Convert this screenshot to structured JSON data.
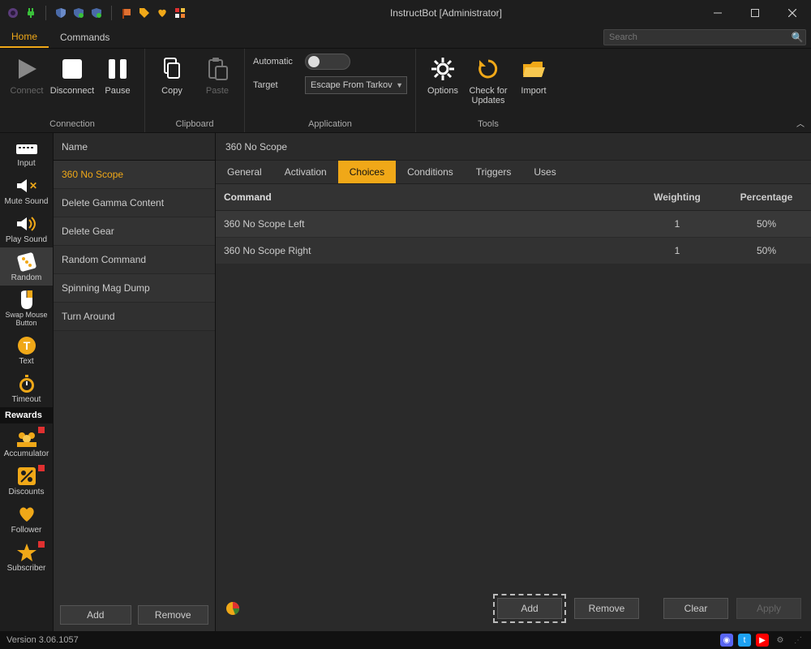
{
  "window": {
    "title": "InstructBot [Administrator]"
  },
  "menubar": {
    "tabs": [
      {
        "label": "Home"
      },
      {
        "label": "Commands"
      }
    ],
    "active": 0,
    "search_placeholder": "Search"
  },
  "ribbon": {
    "groups": {
      "connection": {
        "label": "Connection",
        "items": [
          {
            "label": "Connect",
            "disabled": true
          },
          {
            "label": "Disconnect"
          },
          {
            "label": "Pause"
          }
        ]
      },
      "clipboard": {
        "label": "Clipboard",
        "items": [
          {
            "label": "Copy"
          },
          {
            "label": "Paste",
            "disabled": true
          }
        ]
      },
      "application": {
        "label": "Application",
        "automatic_label": "Automatic",
        "automatic_on": false,
        "target_label": "Target",
        "target_value": "Escape From Tarkov"
      },
      "tools": {
        "label": "Tools",
        "items": [
          {
            "label": "Options"
          },
          {
            "label": "Check for Updates"
          },
          {
            "label": "Import"
          }
        ]
      }
    }
  },
  "sidebar": {
    "items_top": [
      {
        "label": "Input"
      },
      {
        "label": "Mute Sound"
      },
      {
        "label": "Play Sound"
      },
      {
        "label": "Random",
        "selected": true
      },
      {
        "label": "Swap Mouse Button"
      },
      {
        "label": "Text"
      },
      {
        "label": "Timeout"
      }
    ],
    "rewards_header": "Rewards",
    "items_rewards": [
      {
        "label": "Accumulator",
        "badge": true
      },
      {
        "label": "Discounts",
        "badge": true
      },
      {
        "label": "Follower"
      },
      {
        "label": "Subscriber",
        "badge": true
      }
    ]
  },
  "cmdlist": {
    "header": "Name",
    "items": [
      {
        "label": "360 No Scope",
        "selected": true
      },
      {
        "label": "Delete Gamma Content"
      },
      {
        "label": "Delete Gear"
      },
      {
        "label": "Random Command"
      },
      {
        "label": "Spinning Mag Dump"
      },
      {
        "label": "Turn Around"
      }
    ],
    "add_label": "Add",
    "remove_label": "Remove"
  },
  "detail": {
    "title": "360 No Scope",
    "tabs": [
      {
        "label": "General"
      },
      {
        "label": "Activation"
      },
      {
        "label": "Choices",
        "active": true
      },
      {
        "label": "Conditions"
      },
      {
        "label": "Triggers"
      },
      {
        "label": "Uses"
      }
    ],
    "table": {
      "headers": {
        "command": "Command",
        "weighting": "Weighting",
        "percentage": "Percentage"
      },
      "rows": [
        {
          "command": "360 No Scope Left",
          "weighting": "1",
          "percentage": "50%"
        },
        {
          "command": "360 No Scope Right",
          "weighting": "1",
          "percentage": "50%"
        }
      ]
    },
    "footer": {
      "add": "Add",
      "remove": "Remove",
      "clear": "Clear",
      "apply": "Apply"
    }
  },
  "statusbar": {
    "version": "Version 3.06.1057"
  }
}
